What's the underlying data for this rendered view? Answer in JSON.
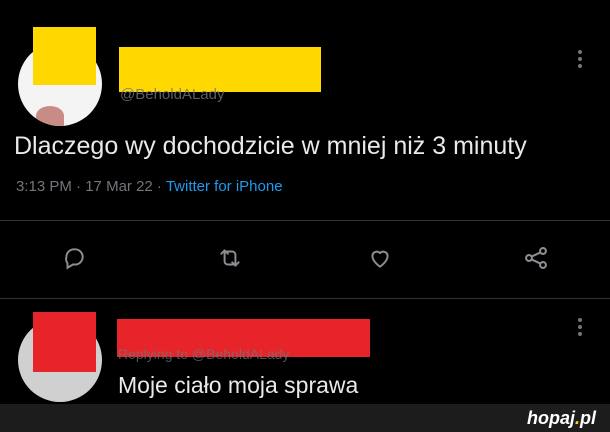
{
  "tweet": {
    "handle": "@BeholdALady",
    "text": "Dlaczego wy dochodzicie w mniej niż 3 minuty",
    "time": "3:13 PM",
    "sep1": " · ",
    "date": "17 Mar 22",
    "sep2": " · ",
    "source": "Twitter for iPhone",
    "actions": [
      "reply-icon",
      "retweet-icon",
      "like-icon",
      "share-icon"
    ]
  },
  "reply": {
    "replying_to": "Replying to @BeholdALady",
    "text": "Moje ciało moja sprawa"
  },
  "watermark": {
    "name": "hopaj",
    "dot": ".",
    "tld": "pl"
  },
  "colors": {
    "background": "#000000",
    "censor_yellow": "#ffd800",
    "censor_red": "#e8242b",
    "link": "#1d9bf0",
    "muted": "#71767b"
  }
}
